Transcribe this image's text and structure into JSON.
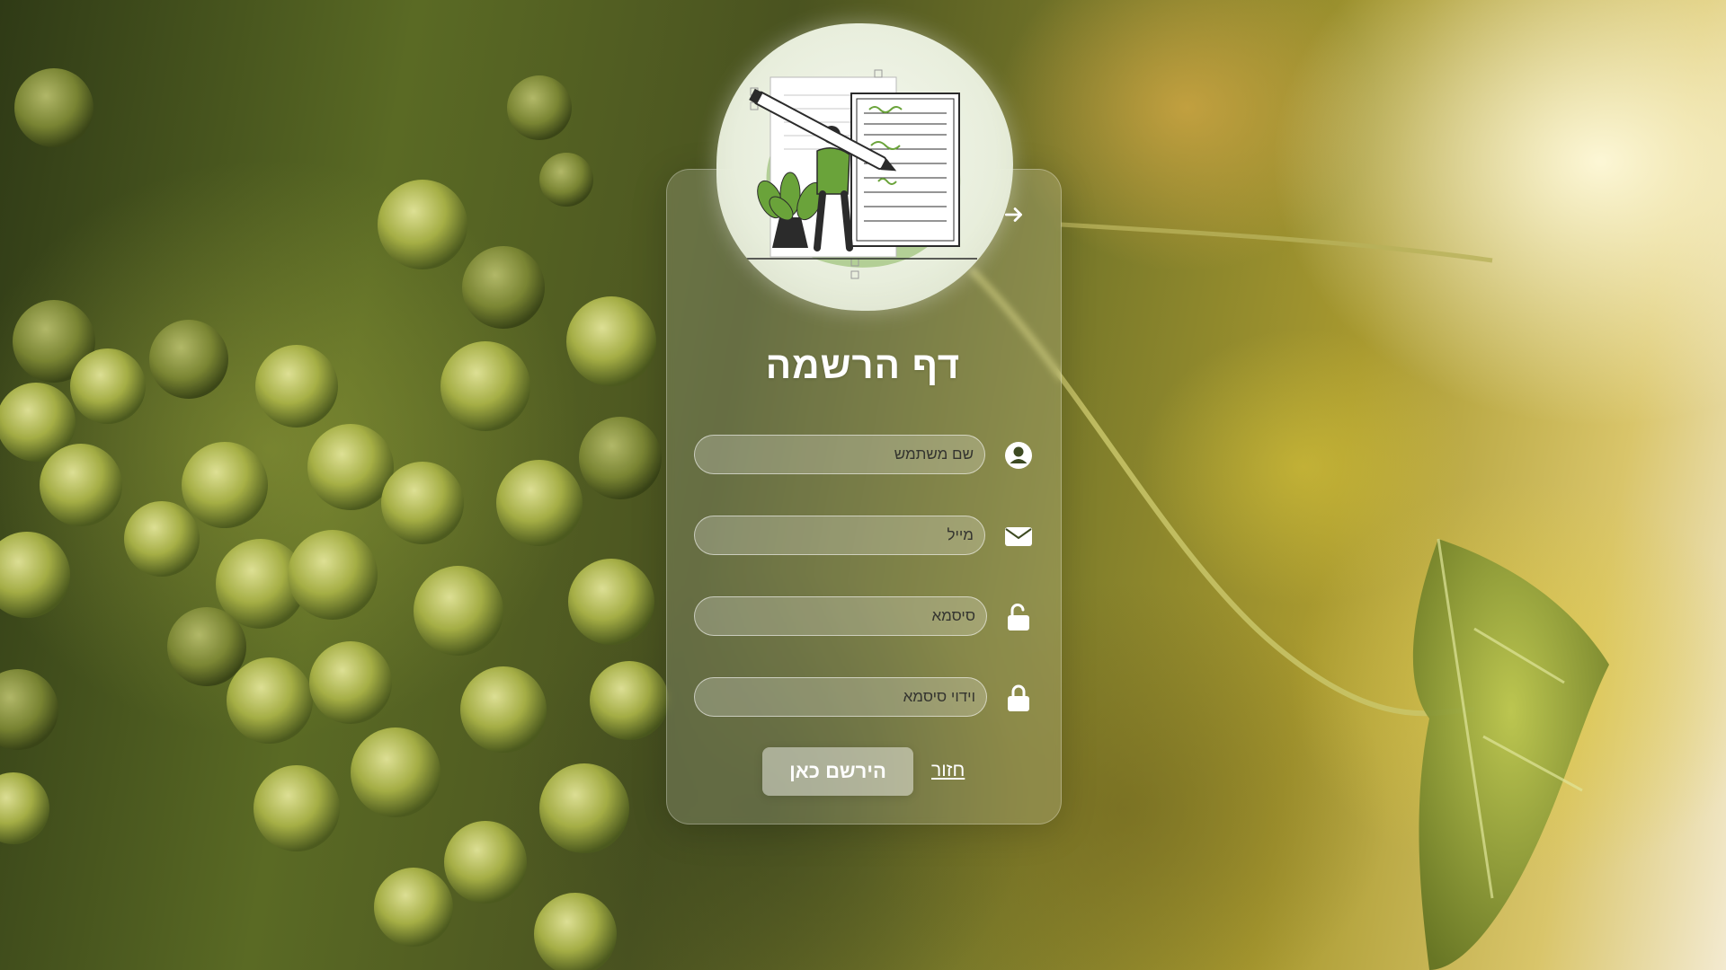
{
  "page": {
    "title": "דף הרשמה"
  },
  "form": {
    "username_placeholder": "שם משתמש",
    "email_placeholder": "מייל",
    "password_placeholder": "סיסמא",
    "confirm_placeholder": "וידוי סיסמא",
    "username_value": "",
    "email_value": "",
    "password_value": "",
    "confirm_value": ""
  },
  "actions": {
    "register_label": "הירשם כאן",
    "back_label": "חזור"
  },
  "icons": {
    "user": "user-circle-icon",
    "email": "envelope-icon",
    "password": "unlock-icon",
    "confirm": "lock-icon",
    "next": "arrow-right-icon"
  },
  "colors": {
    "accent_green": "#6aa33a",
    "card_glass": "rgba(255,255,255,0.16)",
    "text_white": "#ffffff"
  }
}
